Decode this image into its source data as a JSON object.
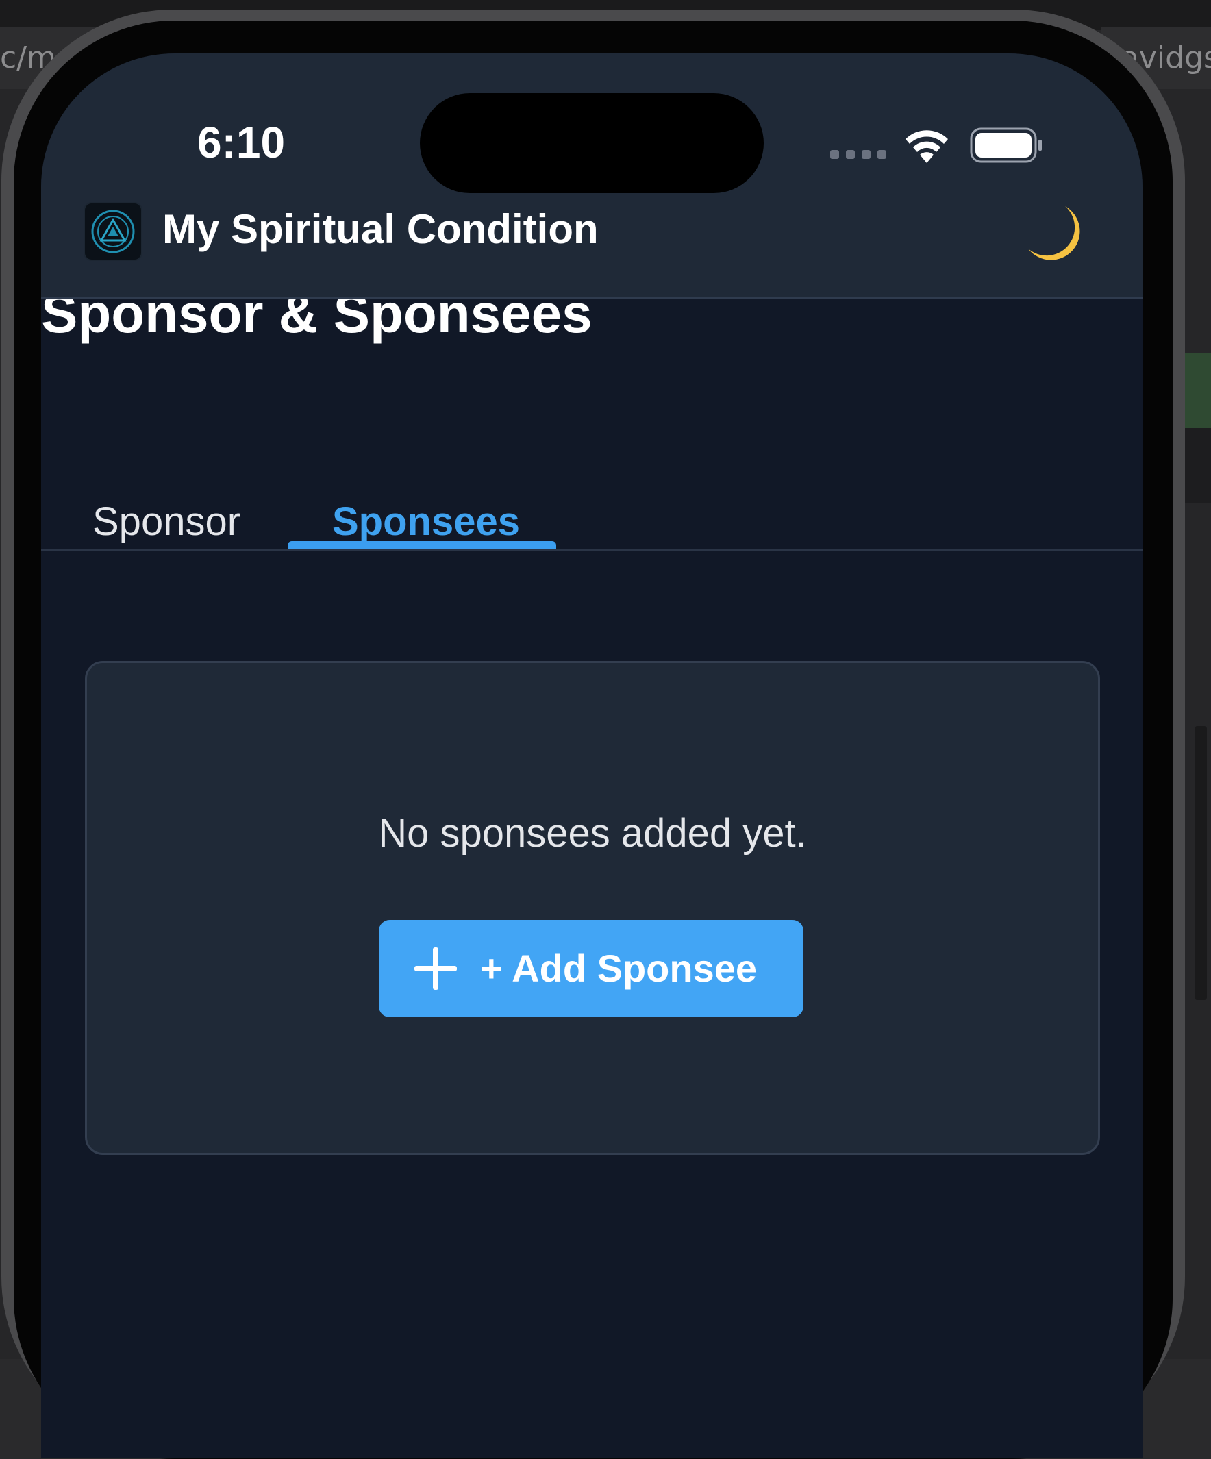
{
  "desktop": {
    "path_left": "c/mos",
    "path_right": "davidgs:"
  },
  "status_bar": {
    "time": "6:10"
  },
  "header": {
    "app_title": "My Spiritual Condition",
    "logo_icon": "aa-logo-icon",
    "theme_icon": "moon-icon"
  },
  "page": {
    "title": "Sponsor & Sponsees"
  },
  "tabs": [
    {
      "label": "Sponsor",
      "active": false
    },
    {
      "label": "Sponsees",
      "active": true
    }
  ],
  "empty_state": {
    "message": "No sponsees added yet.",
    "button_label": "+ Add Sponsee"
  },
  "colors": {
    "accent": "#42a5f5",
    "header_bg": "#1f2937",
    "screen_bg": "#111827",
    "card_bg": "#1f2937"
  }
}
